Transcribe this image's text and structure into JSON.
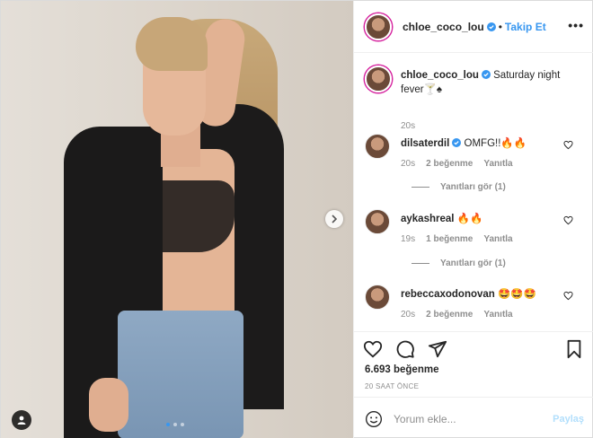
{
  "post": {
    "username": "chloe_coco_lou",
    "separator": "•",
    "follow_label": "Takip Et",
    "more_label": "•••",
    "caption_text": "Saturday night fever",
    "caption_emoji": "🍸♠",
    "caption_time": "20s"
  },
  "comments": [
    {
      "username": "dilsaterdil",
      "verified": true,
      "text": "OMFG!!🔥🔥",
      "time": "20s",
      "likes": "2 beğenme",
      "reply_label": "Yanıtla",
      "view_replies": "Yanıtları gör (1)"
    },
    {
      "username": "aykashreal",
      "verified": false,
      "text": "🔥🔥",
      "time": "19s",
      "likes": "1 beğenme",
      "reply_label": "Yanıtla",
      "view_replies": "Yanıtları gör (1)"
    },
    {
      "username": "rebeccaxodonovan",
      "verified": false,
      "text": "🤩🤩🤩",
      "time": "20s",
      "likes": "2 beğenme",
      "reply_label": "Yanıtla",
      "view_replies": ""
    }
  ],
  "actions": {
    "likes_count": "6.693 beğenme",
    "timestamp": "20 SAAT ÖNCE"
  },
  "comment_box": {
    "placeholder": "Yorum ekle...",
    "post_label": "Paylaş"
  },
  "colors": {
    "accent": "#3897f0",
    "muted": "#8e8e8e",
    "text": "#262626",
    "border": "#efefef"
  },
  "icons": {
    "verified": "verified-badge-icon",
    "like": "heart-icon",
    "comment": "comment-icon",
    "share": "share-icon",
    "save": "bookmark-icon",
    "emoji": "emoji-icon",
    "next": "chevron-right-icon",
    "tag": "user-tag-icon"
  },
  "carousel": {
    "slides": 3,
    "active": 1
  }
}
